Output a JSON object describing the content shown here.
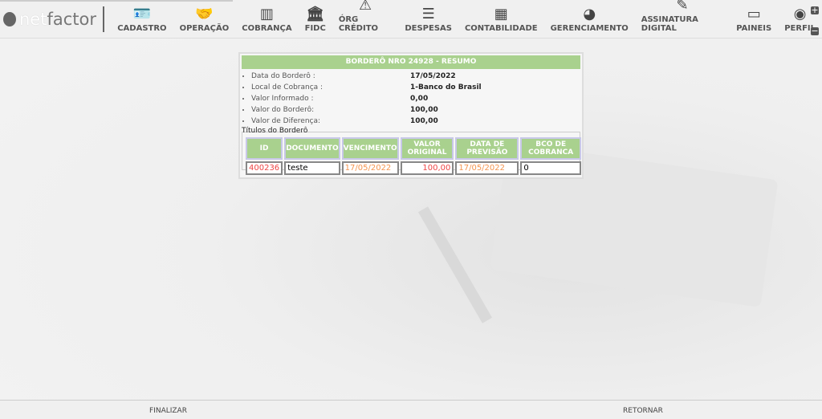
{
  "brand": {
    "logo_text_a": "net",
    "logo_text_b": "factor"
  },
  "nav": [
    {
      "label": "CADASTRO",
      "icon": "id-card-icon",
      "glyph": "🪪"
    },
    {
      "label": "OPERAÇÃO",
      "icon": "handshake-icon",
      "glyph": "🤝"
    },
    {
      "label": "COBRANÇA",
      "icon": "barcode-icon",
      "glyph": "▥"
    },
    {
      "label": "FIDC",
      "icon": "bank-icon",
      "glyph": "🏛"
    },
    {
      "label": "ÓRG CRÉDITO",
      "icon": "warning-icon",
      "glyph": "⚠"
    },
    {
      "label": "DESPESAS",
      "icon": "list-icon",
      "glyph": "☰"
    },
    {
      "label": "CONTABILIDADE",
      "icon": "calculator-icon",
      "glyph": "▦"
    },
    {
      "label": "GERENCIAMENTO",
      "icon": "pie-chart-icon",
      "glyph": "◕"
    },
    {
      "label": "ASSINATURA DIGITAL",
      "icon": "edit-icon",
      "glyph": "✎"
    },
    {
      "label": "PAINEIS",
      "icon": "monitor-icon",
      "glyph": "▭"
    },
    {
      "label": "PERFIL",
      "icon": "user-circle-icon",
      "glyph": "◉"
    }
  ],
  "panel": {
    "title": "BORDERÔ NRO 24928 - RESUMO",
    "fields": [
      {
        "label": "Data do Borderô :",
        "value": "17/05/2022"
      },
      {
        "label": "Local de Cobrança :",
        "value": "1-Banco do Brasil"
      },
      {
        "label": "Valor Informado :",
        "value": "0,00"
      },
      {
        "label": "Valor do Borderô:",
        "value": "100,00"
      },
      {
        "label": "Valor de Diferença:",
        "value": "100,00"
      }
    ],
    "section": "Títulos do Borderô",
    "columns": [
      "ID",
      "DOCUMENTO",
      "VENCIMENTO",
      "VALOR ORIGINAL",
      "DATA DE PREVISÃO",
      "BCO DE COBRANCA"
    ],
    "rows": [
      [
        "400236",
        "teste",
        "17/05/2022",
        "100,00",
        "17/05/2022",
        "0"
      ]
    ]
  },
  "footer": {
    "finalize": "FINALIZAR",
    "back": "RETORNAR"
  }
}
